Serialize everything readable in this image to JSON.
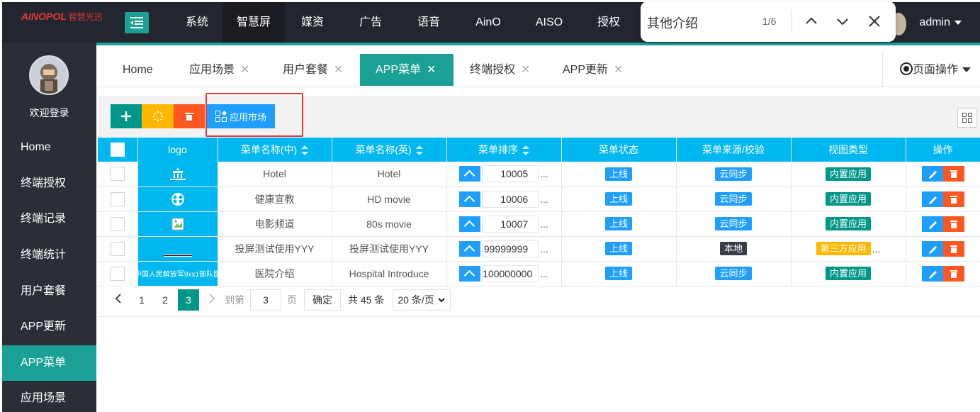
{
  "header": {
    "logo_text": "AINOPOL",
    "logo_cn": "智慧光迅",
    "nav": [
      "系统",
      "智慧屏",
      "媒资",
      "广告",
      "语音",
      "AinO",
      "AISO",
      "授权"
    ],
    "active_nav": "智慧屏",
    "user": "admin"
  },
  "find": {
    "query": "其他介绍",
    "count": "1/6"
  },
  "sidebar": {
    "welcome": "欢迎登录",
    "items": [
      "Home",
      "终端授权",
      "终端记录",
      "终端统计",
      "用户套餐",
      "APP更新",
      "APP菜单",
      "应用场景"
    ],
    "active": "APP菜单"
  },
  "tabs": [
    {
      "label": "Home",
      "closable": false
    },
    {
      "label": "应用场景",
      "closable": true
    },
    {
      "label": "用户套餐",
      "closable": true
    },
    {
      "label": "APP菜单",
      "closable": true
    },
    {
      "label": "终端授权",
      "closable": true
    },
    {
      "label": "APP更新",
      "closable": true
    }
  ],
  "page_ops": "页面操作",
  "toolbar": {
    "market_label": "应用市场"
  },
  "table": {
    "headers": [
      "logo",
      "菜单名称(中)",
      "菜单名称(英)",
      "菜单排序",
      "菜单状态",
      "菜单来源/校验",
      "视图类型",
      "操作"
    ],
    "rows": [
      {
        "name_cn": "Hotel",
        "name_en": "Hotel",
        "order": "10005",
        "status": "上线",
        "source": "云同步",
        "view": "内置应用"
      },
      {
        "name_cn": "健康宣教",
        "name_en": "HD movie",
        "order": "10006",
        "status": "上线",
        "source": "云同步",
        "view": "内置应用"
      },
      {
        "name_cn": "电影频道",
        "name_en": "80s movie",
        "order": "10007",
        "status": "上线",
        "source": "云同步",
        "view": "内置应用"
      },
      {
        "name_cn": "投屏测试使用YYY",
        "name_en": "投屏测试使用YYY",
        "order": "99999999",
        "status": "上线",
        "source": "本地",
        "view": "第三方应用"
      },
      {
        "name_cn": "医院介绍",
        "name_en": "Hospital Introduce",
        "order": "100000000",
        "status": "上线",
        "source": "云同步",
        "view": "内置应用",
        "logo_text": "中国人民解放军9xx1部队医"
      }
    ],
    "ellipsis": "..."
  },
  "pager": {
    "pages": [
      "1",
      "2",
      "3"
    ],
    "current": "3",
    "goto_label": "到第",
    "goto_value": "3",
    "page_unit": "页",
    "confirm": "确定",
    "total": "共 45 条",
    "page_size": "20 条/页"
  },
  "colors": {
    "accent": "#1aa094",
    "header_bg": "#23262e",
    "table_header": "#00b7f0",
    "blue_btn": "#1e9fff",
    "orange_btn": "#ff5722",
    "yellow_btn": "#ffb800"
  }
}
